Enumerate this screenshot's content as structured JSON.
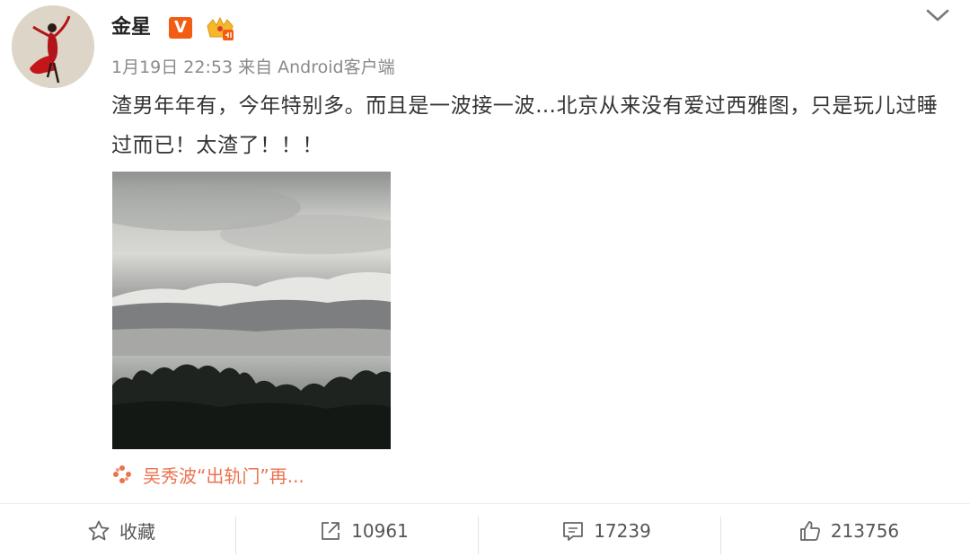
{
  "post": {
    "author": "金星",
    "verified_badge": "V",
    "meta": "1月19日 22:53 来自 Android客户端",
    "content": "渣男年年有，今年特别多。而且是一波接一波…北京从来没有爱过西雅图，只是玩儿过睡过而已！太渣了！！！",
    "topic": "吴秀波“出轨门”再..."
  },
  "actions": {
    "favorite_label": "收藏",
    "repost_count": "10961",
    "comment_count": "17239",
    "like_count": "213756"
  },
  "colors": {
    "accent": "#eb7350",
    "verified": "#f25d13",
    "meta_text": "#8a8a8a"
  },
  "icons": [
    "avatar",
    "verified-v-icon",
    "crown-membership-icon",
    "chevron-down-icon",
    "topic-icon",
    "star-icon",
    "repost-icon",
    "comment-icon",
    "thumbs-up-icon"
  ]
}
